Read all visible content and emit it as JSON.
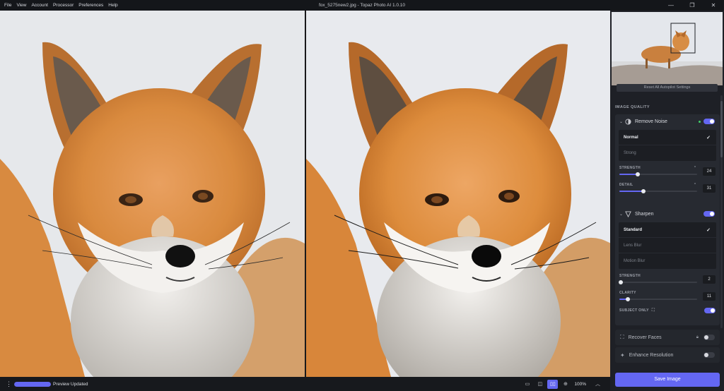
{
  "window": {
    "title": "fox_5275new2.jpg - Topaz Photo AI 1.0.10",
    "controls": {
      "minimize": "—",
      "restore": "❐",
      "close": "✕"
    }
  },
  "menu": [
    "File",
    "View",
    "Account",
    "Processor",
    "Preferences",
    "Help"
  ],
  "sidebar": {
    "reset_button": "Reset All Autopilot Settings",
    "section_title": "IMAGE QUALITY",
    "remove_noise": {
      "label": "Remove Noise",
      "enabled": true,
      "options": [
        "Normal",
        "Strong"
      ],
      "selected": "Normal",
      "strength_label": "STRENGTH",
      "strength_value": "24",
      "strength_percent": 24,
      "detail_label": "DETAIL",
      "detail_value": "31",
      "detail_percent": 31
    },
    "sharpen": {
      "label": "Sharpen",
      "enabled": true,
      "options": [
        "Standard",
        "Lens Blur",
        "Motion Blur"
      ],
      "selected": "Standard",
      "strength_label": "STRENGTH",
      "strength_value": "2",
      "strength_percent": 2,
      "clarity_label": "CLARITY",
      "clarity_value": "11",
      "clarity_percent": 11,
      "subject_only_label": "SUBJECT ONLY",
      "subject_only_enabled": true
    },
    "recover_faces": {
      "label": "Recover Faces",
      "enabled": false
    },
    "enhance_resolution": {
      "label": "Enhance Resolution",
      "enabled": false
    },
    "save_button": "Save Image"
  },
  "statusbar": {
    "progress_percent": 100,
    "status_text": "Preview Updated",
    "zoom": "100%"
  },
  "colors": {
    "accent": "#6467f2",
    "panel": "#1e2026",
    "card": "#272a31"
  },
  "icons": [
    "kebab-menu-icon",
    "single-view-icon",
    "split-view-icon",
    "side-by-side-icon",
    "zoom-icon",
    "chevron-up-icon",
    "lock-icon",
    "face-scan-icon",
    "enhance-icon",
    "noise-icon",
    "sharpen-icon",
    "subject-icon",
    "check-icon"
  ]
}
